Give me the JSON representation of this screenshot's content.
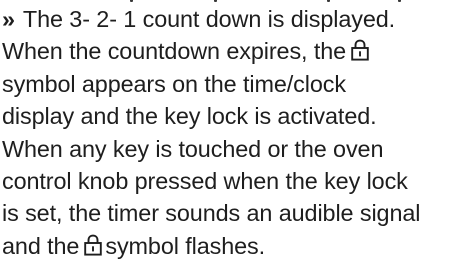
{
  "instructions": {
    "bullet_marker": "»",
    "line_1": "The 3- 2- 1 count down is displayed.",
    "line_2_before_icon": "When the countdown expires, the",
    "line_3": "symbol appears on the time/clock",
    "line_4": "display and the key lock is activated.",
    "line_5": "When any key is touched or the oven",
    "line_6": "control knob pressed when the key lock",
    "line_7": "is set, the timer sounds an audible signal",
    "line_8_before_icon": "and the",
    "line_8_after_icon": "symbol flashes.",
    "icon": "key-lock-icon"
  }
}
